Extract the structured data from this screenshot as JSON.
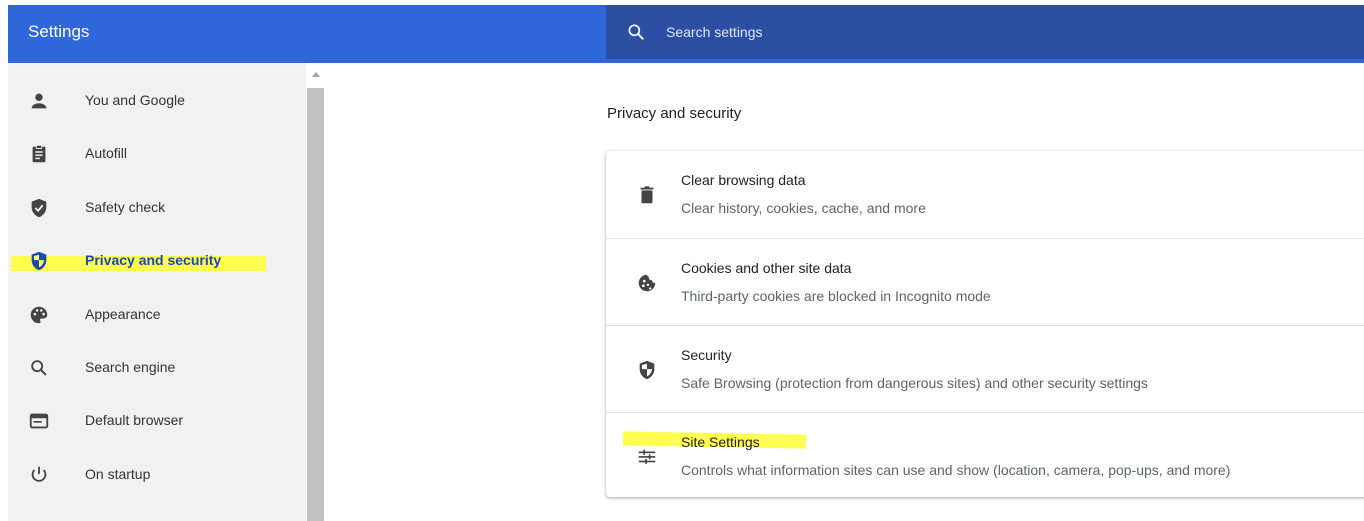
{
  "header": {
    "title": "Settings",
    "search_placeholder": "Search settings"
  },
  "sidebar": {
    "items": [
      {
        "label": "You and Google",
        "icon": "person-icon"
      },
      {
        "label": "Autofill",
        "icon": "clipboard-icon"
      },
      {
        "label": "Safety check",
        "icon": "shield-check-icon"
      },
      {
        "label": "Privacy and security",
        "icon": "shield-half-icon",
        "active": true,
        "highlighted": true
      },
      {
        "label": "Appearance",
        "icon": "palette-icon"
      },
      {
        "label": "Search engine",
        "icon": "search-icon"
      },
      {
        "label": "Default browser",
        "icon": "browser-window-icon"
      },
      {
        "label": "On startup",
        "icon": "power-icon"
      }
    ]
  },
  "main": {
    "section_title": "Privacy and security",
    "rows": [
      {
        "title": "Clear browsing data",
        "subtitle": "Clear history, cookies, cache, and more",
        "icon": "trash-icon"
      },
      {
        "title": "Cookies and other site data",
        "subtitle": "Third-party cookies are blocked in Incognito mode",
        "icon": "cookie-icon"
      },
      {
        "title": "Security",
        "subtitle": "Safe Browsing (protection from dangerous sites) and other security settings",
        "icon": "shield-half-icon"
      },
      {
        "title": "Site Settings",
        "subtitle": "Controls what information sites can use and show (location, camera, pop-ups, and more)",
        "icon": "tune-icon",
        "highlighted": true
      }
    ]
  },
  "colors": {
    "header_bg": "#2f66d8",
    "search_bg": "#2c4fa3",
    "sidebar_bg": "#f1f1f1",
    "active_text": "#1a47b8",
    "highlight": "#ffff33"
  }
}
